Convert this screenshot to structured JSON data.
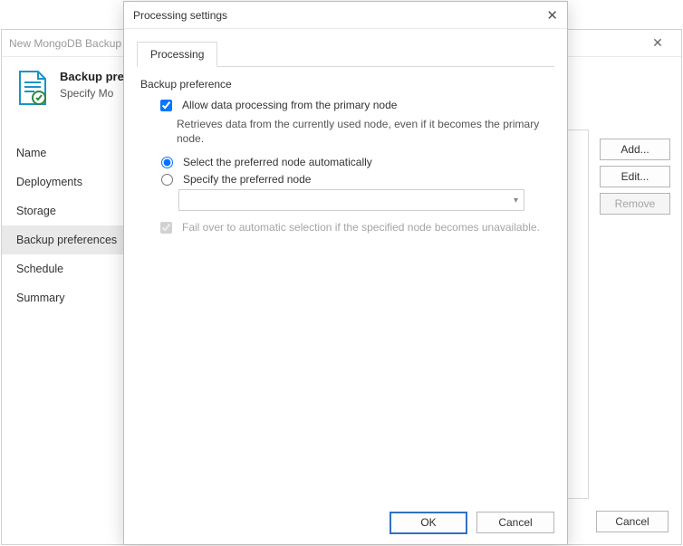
{
  "wizard": {
    "window_title": "New MongoDB Backup",
    "header_title": "Backup preferences",
    "header_sub": "Specify Mo",
    "nav": [
      "Name",
      "Deployments",
      "Storage",
      "Backup preferences",
      "Schedule",
      "Summary"
    ],
    "nav_selected_index": 3,
    "right_buttons": {
      "add": "Add...",
      "edit": "Edit...",
      "remove": "Remove"
    },
    "footer": {
      "cancel": "Cancel"
    }
  },
  "modal": {
    "title": "Processing settings",
    "tab": "Processing",
    "group_title": "Backup preference",
    "allow_primary": {
      "label": "Allow data processing from the primary node",
      "checked": true,
      "helper": "Retrieves data from the currently used node, even if it becomes the primary node."
    },
    "mode": {
      "auto": "Select the preferred node automatically",
      "specify": "Specify the preferred node",
      "selected": "auto"
    },
    "failover": {
      "label": "Fail over to automatic selection if the specified node becomes unavailable.",
      "checked": true
    },
    "buttons": {
      "ok": "OK",
      "cancel": "Cancel"
    }
  }
}
